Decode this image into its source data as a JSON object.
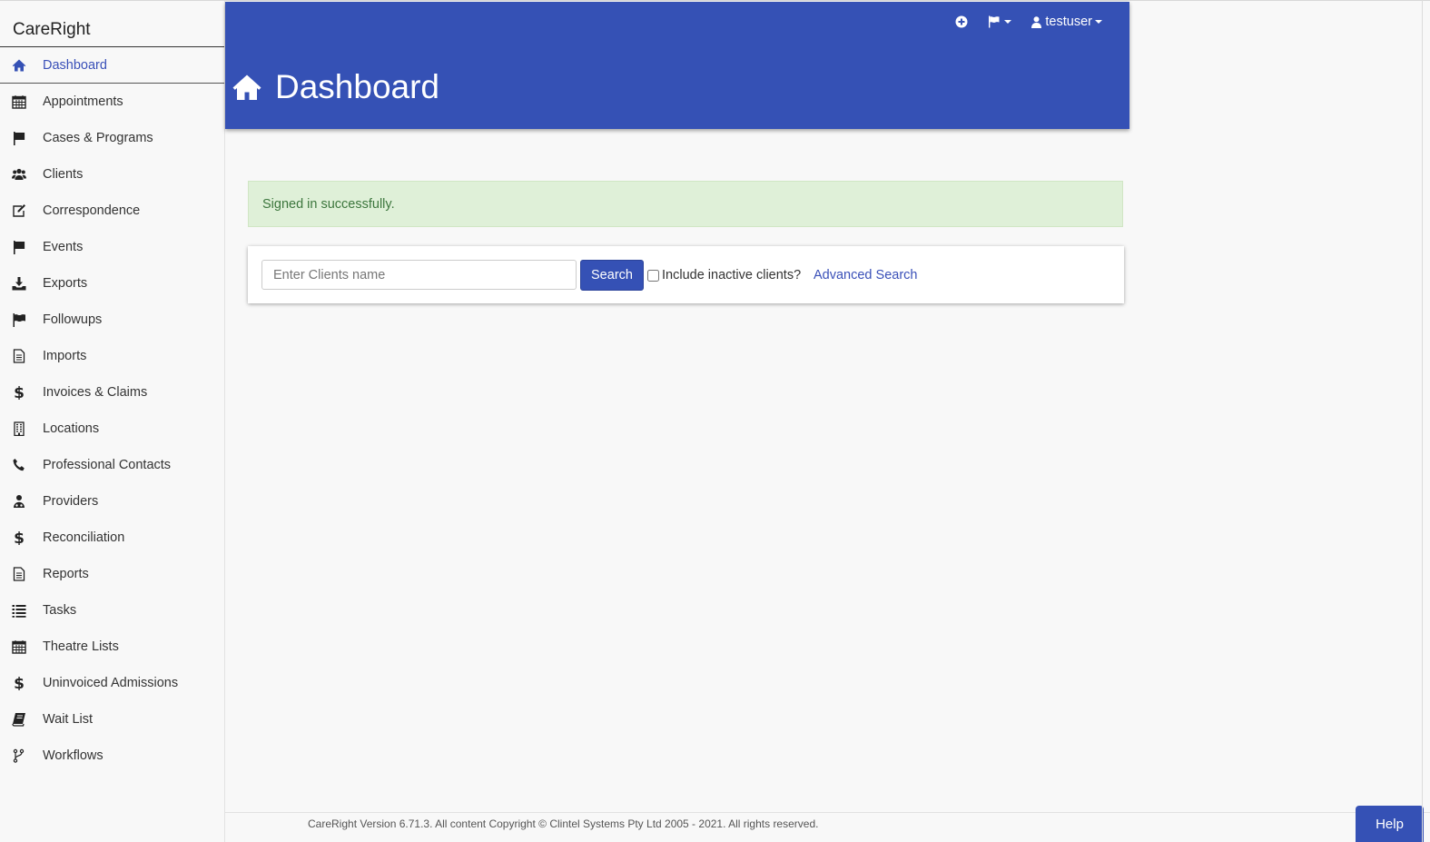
{
  "app": {
    "brand": "CareRight"
  },
  "sidebar": {
    "items": [
      {
        "label": "Dashboard",
        "icon": "home-icon"
      },
      {
        "label": "Appointments",
        "icon": "calendar-icon"
      },
      {
        "label": "Cases & Programs",
        "icon": "flag-icon"
      },
      {
        "label": "Clients",
        "icon": "users-icon"
      },
      {
        "label": "Correspondence",
        "icon": "edit-icon"
      },
      {
        "label": "Events",
        "icon": "flag-icon"
      },
      {
        "label": "Exports",
        "icon": "download-icon"
      },
      {
        "label": "Followups",
        "icon": "flag-wave-icon"
      },
      {
        "label": "Imports",
        "icon": "document-icon"
      },
      {
        "label": "Invoices & Claims",
        "icon": "dollar-icon"
      },
      {
        "label": "Locations",
        "icon": "building-icon"
      },
      {
        "label": "Professional Contacts",
        "icon": "phone-icon"
      },
      {
        "label": "Providers",
        "icon": "doctor-icon"
      },
      {
        "label": "Reconciliation",
        "icon": "dollar-icon"
      },
      {
        "label": "Reports",
        "icon": "document-icon"
      },
      {
        "label": "Tasks",
        "icon": "list-icon"
      },
      {
        "label": "Theatre Lists",
        "icon": "calendar-icon"
      },
      {
        "label": "Uninvoiced Admissions",
        "icon": "dollar-icon"
      },
      {
        "label": "Wait List",
        "icon": "book-icon"
      },
      {
        "label": "Workflows",
        "icon": "branch-icon"
      }
    ]
  },
  "header": {
    "title": "Dashboard",
    "user": "testuser",
    "icons": [
      "plus-circle-icon",
      "flag-icon",
      "user-icon"
    ]
  },
  "alert": {
    "message": "Signed in successfully."
  },
  "search": {
    "placeholder": "Enter Clients name",
    "value": "",
    "button_label": "Search",
    "inactive_label": "Include inactive clients?",
    "advanced_label": "Advanced Search"
  },
  "footer": {
    "text": "CareRight Version 6.71.3. All content Copyright © Clintel Systems Pty Ltd 2005 - 2021. All rights reserved."
  },
  "help": {
    "label": "Help"
  },
  "colors": {
    "primary": "#3551b5",
    "alert_bg": "#dff0d8",
    "alert_text": "#3c763d"
  }
}
